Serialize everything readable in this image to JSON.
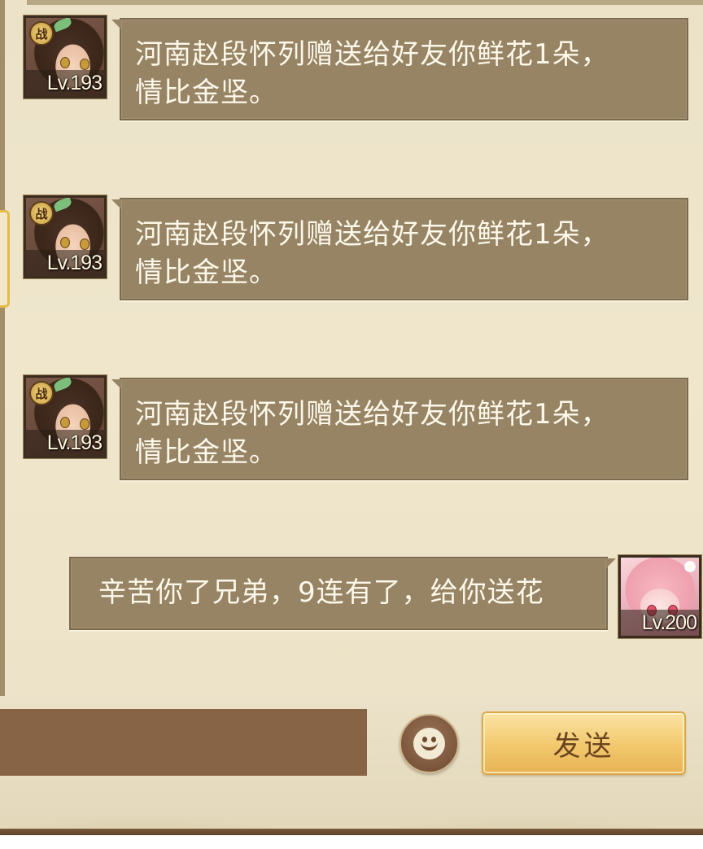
{
  "messages": [
    {
      "sender": "other",
      "badge": "战",
      "level": "Lv.193",
      "line1": "河南赵段怀列赠送给好友你鲜花1朵，",
      "line2": "情比金坚。"
    },
    {
      "sender": "other",
      "badge": "战",
      "level": "Lv.193",
      "line1": "河南赵段怀列赠送给好友你鲜花1朵，",
      "line2": "情比金坚。"
    },
    {
      "sender": "other",
      "badge": "战",
      "level": "Lv.193",
      "line1": "河南赵段怀列赠送给好友你鲜花1朵，",
      "line2": "情比金坚。"
    },
    {
      "sender": "self",
      "level": "Lv.200",
      "text": "辛苦你了兄弟，9连有了，给你送花"
    }
  ],
  "input": {
    "value": "",
    "placeholder": ""
  },
  "emoji_icon": "smiley-face-icon",
  "send_label": "发送",
  "colors": {
    "bubble": "#968465",
    "input_field": "#876446",
    "send_button": "#f2c86d",
    "background": "#ebe2c8"
  }
}
